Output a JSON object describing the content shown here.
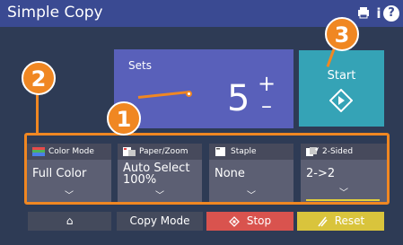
{
  "titlebar": {
    "title": "Simple Copy",
    "info_label": "i",
    "help_label": "?"
  },
  "sets": {
    "label": "Sets",
    "value": "5",
    "plus": "+",
    "minus": "–"
  },
  "start": {
    "label": "Start"
  },
  "functions": [
    {
      "title": "Color Mode",
      "value": "Full Color",
      "icon": "color-mode-icon"
    },
    {
      "title": "Paper/Zoom",
      "value": "Auto Select\n100%",
      "icon": "paper-zoom-icon"
    },
    {
      "title": "Staple",
      "value": "None",
      "icon": "staple-icon"
    },
    {
      "title": "2-Sided",
      "value": "2->2",
      "icon": "two-sided-icon"
    }
  ],
  "bottom": {
    "home_label": "⌂",
    "copy_mode_label": "Copy Mode",
    "stop_label": "Stop",
    "reset_label": "Reset"
  },
  "callouts": [
    "1",
    "2",
    "3"
  ],
  "colors": {
    "accent": "#f08722",
    "titlebar": "#3a4a92",
    "start": "#35a3b6",
    "stop": "#d9534e",
    "reset": "#d9c43c",
    "sets_panel": "#5960ba"
  }
}
